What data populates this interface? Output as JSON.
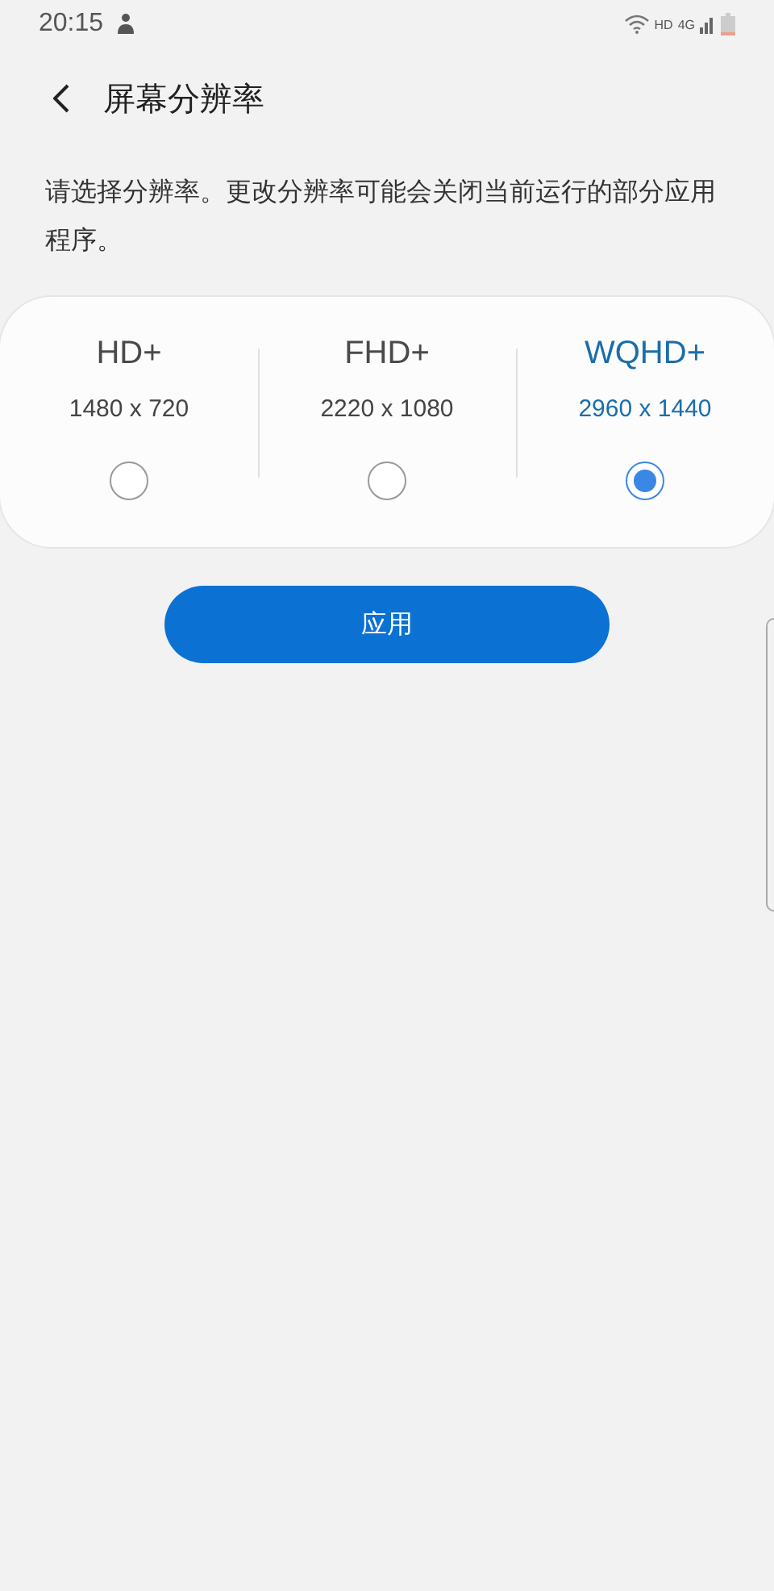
{
  "status_bar": {
    "time": "20:15",
    "hd": "HD",
    "network": "4G"
  },
  "header": {
    "title": "屏幕分辨率"
  },
  "description": "请选择分辨率。更改分辨率可能会关闭当前运行的部分应用程序。",
  "options": [
    {
      "label": "HD+",
      "resolution": "1480 x 720",
      "selected": false
    },
    {
      "label": "FHD+",
      "resolution": "2220 x 1080",
      "selected": false
    },
    {
      "label": "WQHD+",
      "resolution": "2960 x 1440",
      "selected": true
    }
  ],
  "apply_button": "应用"
}
